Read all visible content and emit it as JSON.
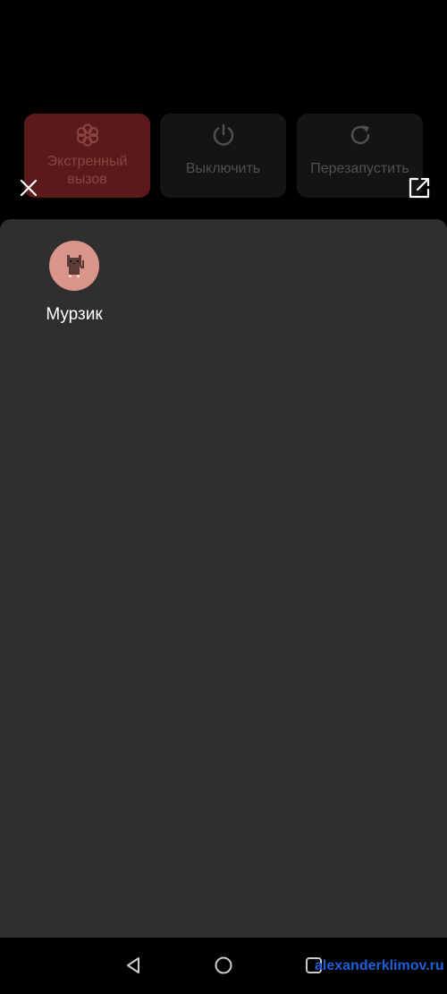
{
  "power_menu": {
    "emergency_label": "Экстренный вызов",
    "power_off_label": "Выключить",
    "restart_label": "Перезапустить"
  },
  "users": [
    {
      "name": "Мурзик"
    }
  ],
  "watermark": "alexanderklimov.ru",
  "colors": {
    "emergency_bg": "#5a1a1a",
    "sheet_bg": "#2f2f30",
    "avatar_bg": "#d9958a",
    "watermark": "#1e5fd8"
  },
  "icons": {
    "emergency": "asterisk-icon",
    "power_off": "power-icon",
    "restart": "restart-icon",
    "close": "close-icon",
    "open_external": "open-external-icon",
    "back": "nav-back-icon",
    "home": "nav-home-icon",
    "recents": "nav-recents-icon"
  }
}
